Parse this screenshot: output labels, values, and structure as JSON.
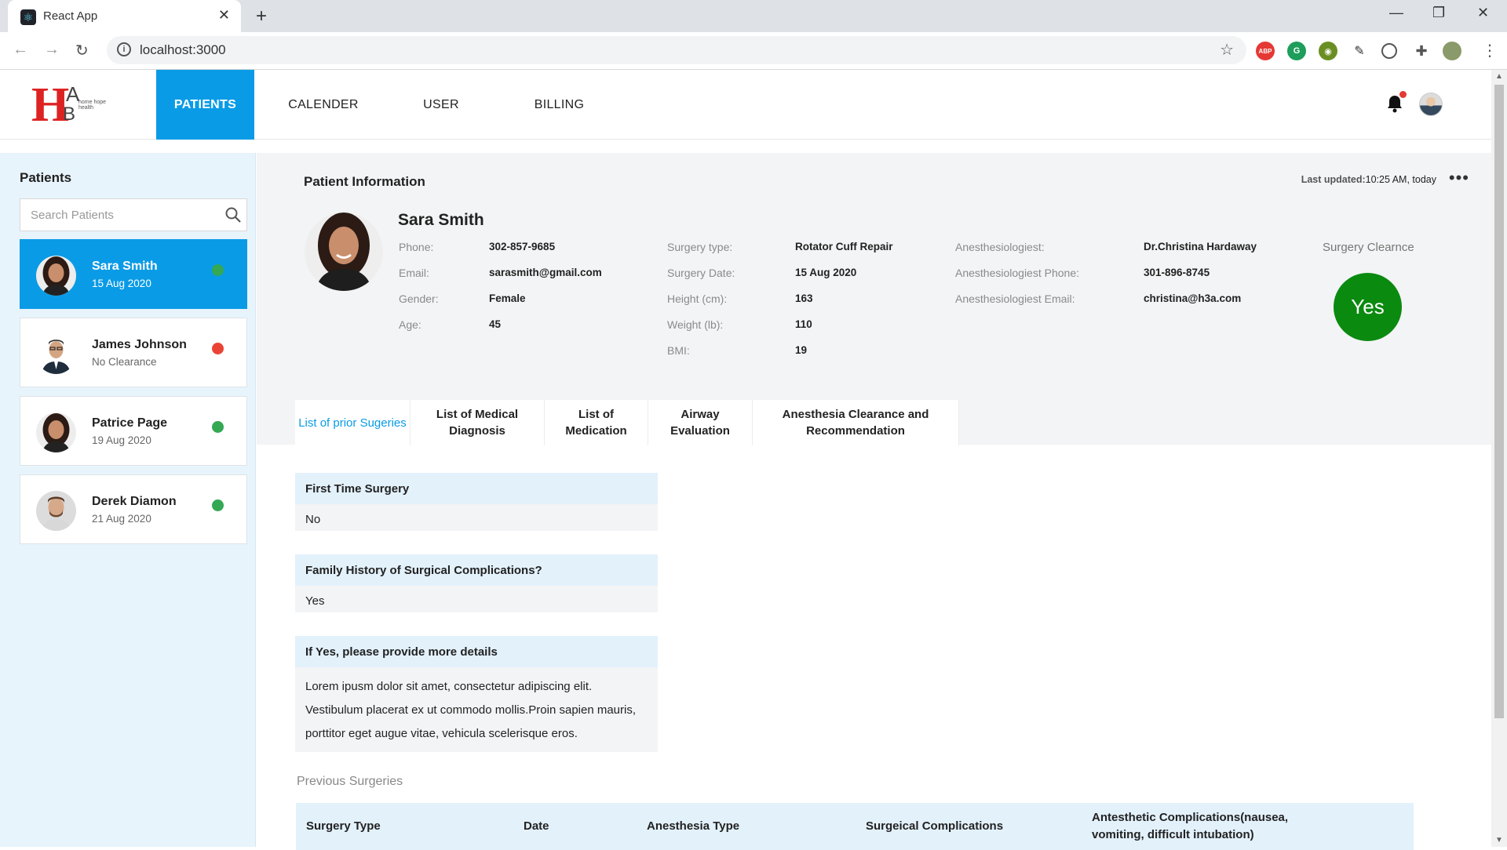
{
  "browser": {
    "tab_title": "React App",
    "url": "localhost:3000"
  },
  "nav": {
    "items": [
      "PATIENTS",
      "CALENDER",
      "USER",
      "BILLING"
    ],
    "active": "PATIENTS"
  },
  "logo": {
    "letters_a": "A",
    "letters_b": "B",
    "letters_h": "H",
    "tagline": "home hope health"
  },
  "sidebar": {
    "title": "Patients",
    "search_placeholder": "Search Patients",
    "patients": [
      {
        "name": "Sara Smith",
        "subtitle": "15 Aug 2020",
        "status": "green",
        "active": true
      },
      {
        "name": "James Johnson",
        "subtitle": "No Clearance",
        "status": "red",
        "active": false
      },
      {
        "name": "Patrice Page",
        "subtitle": "19 Aug 2020",
        "status": "green",
        "active": false
      },
      {
        "name": "Derek Diamon",
        "subtitle": "21 Aug 2020",
        "status": "green",
        "active": false
      }
    ]
  },
  "patient_info": {
    "title": "Patient Information",
    "last_updated_label": "Last updated:",
    "last_updated_value": "10:25 AM, today",
    "name": "Sara Smith",
    "col1": [
      {
        "label": "Phone:",
        "value": "302-857-9685"
      },
      {
        "label": "Email:",
        "value": "sarasmith@gmail.com"
      },
      {
        "label": "Gender:",
        "value": "Female"
      },
      {
        "label": "Age:",
        "value": "45"
      }
    ],
    "col2": [
      {
        "label": "Surgery type:",
        "value": "Rotator Cuff Repair"
      },
      {
        "label": "Surgery Date:",
        "value": "15 Aug 2020"
      },
      {
        "label": "Height (cm):",
        "value": "163"
      },
      {
        "label": "Weight (lb):",
        "value": "110"
      },
      {
        "label": "BMI:",
        "value": "19"
      }
    ],
    "col3": [
      {
        "label": "Anesthesiologiest:",
        "value": "Dr.Christina Hardaway"
      },
      {
        "label": "Anesthesiologiest Phone:",
        "value": "301-896-8745"
      },
      {
        "label": "Anesthesiologiest Email:",
        "value": "christina@h3a.com"
      }
    ],
    "clearance_label": "Surgery Clearnce",
    "clearance_value": "Yes"
  },
  "tabs": [
    {
      "label": "List of prior Sugeries",
      "active": true
    },
    {
      "label": "List of Medical Diagnosis",
      "active": false
    },
    {
      "label": "List of Medication",
      "active": false
    },
    {
      "label": "Airway Evaluation",
      "active": false
    },
    {
      "label": "Anesthesia Clearance and Recommendation",
      "active": false
    }
  ],
  "qa": [
    {
      "question": "First Time Surgery",
      "answer": "No"
    },
    {
      "question": "Family History of Surgical Complications?",
      "answer": "Yes"
    },
    {
      "question": "If Yes, please provide more details",
      "answer": "Lorem ipusm dolor sit amet, consectetur adipiscing elit. Vestibulum placerat ex ut commodo mollis.Proin sapien mauris, porttitor eget augue vitae, vehicula scelerisque eros."
    }
  ],
  "previous_surgeries": {
    "label": "Previous Surgeries",
    "columns": [
      "Surgery Type",
      "Date",
      "Anesthesia Type",
      "Surgeical Complications",
      "Antesthetic Complications(nausea, vomiting, difficult intubation)"
    ]
  },
  "colors": {
    "accent": "#0a9be6",
    "status_green": "#34a853",
    "status_red": "#ea4335",
    "clearance_green": "#0b8a10",
    "sidebar_bg": "#e8f4fc"
  }
}
